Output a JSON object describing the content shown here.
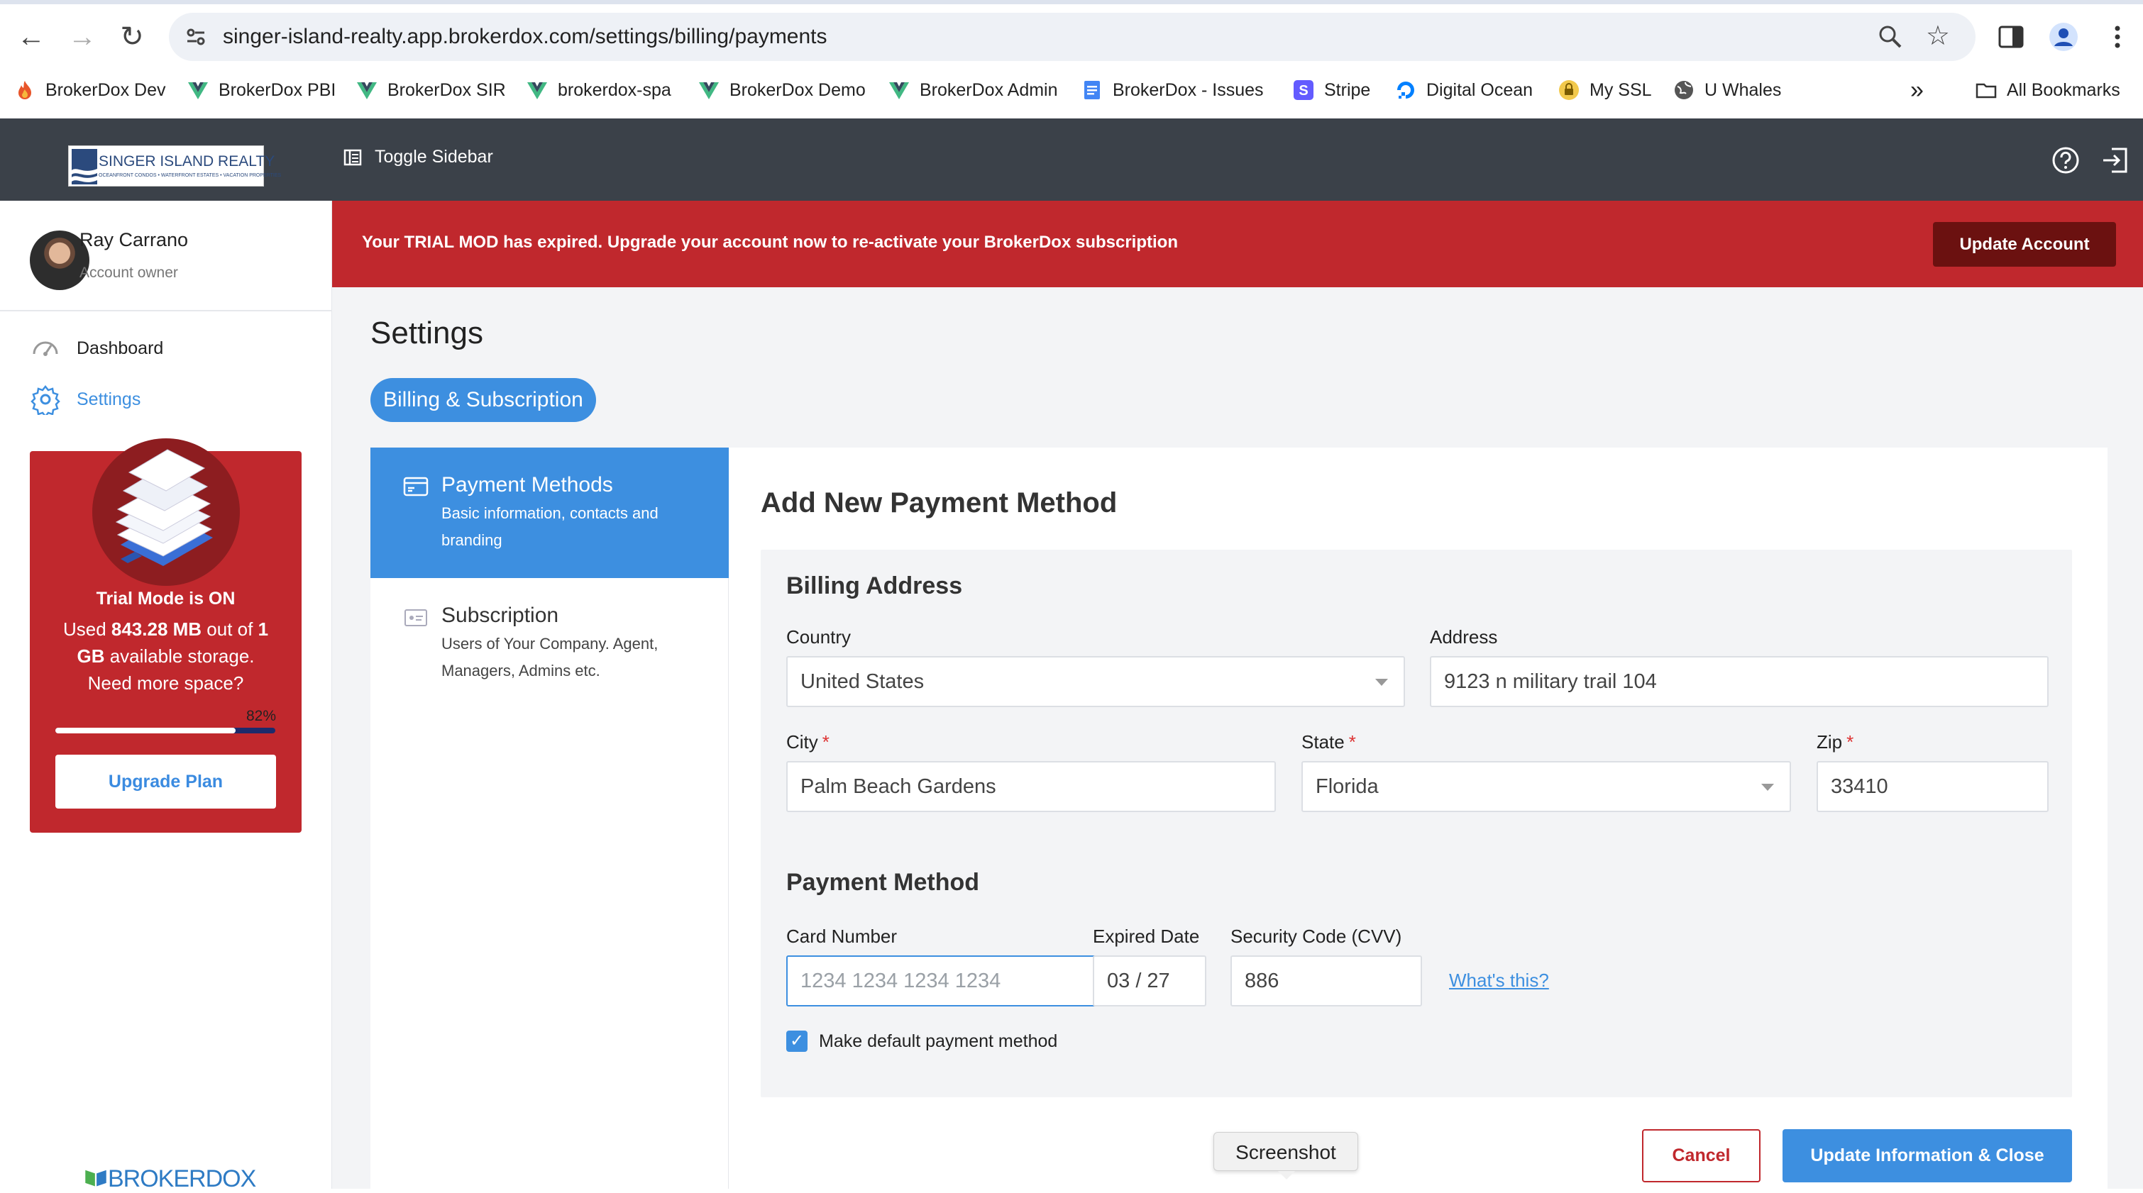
{
  "browser": {
    "url": "singer-island-realty.app.brokerdox.com/settings/billing/payments",
    "bookmarks": [
      "BrokerDox Dev",
      "BrokerDox PBI",
      "BrokerDox SIR",
      "brokerdox-spa",
      "BrokerDox Demo",
      "BrokerDox Admin",
      "BrokerDox - Issues",
      "Stripe",
      "Digital Ocean",
      "My SSL",
      "U Whales"
    ],
    "overflow": "»",
    "all_bookmarks": "All Bookmarks"
  },
  "header": {
    "logo_text": "SINGER ISLAND REALTY",
    "logo_sub": "OCEANFRONT CONDOS • WATERFRONT ESTATES • VACATION PROPERTIES",
    "toggle_label": "Toggle Sidebar"
  },
  "user": {
    "name": "Ray Carrano",
    "role": "Account owner"
  },
  "nav": {
    "dashboard": "Dashboard",
    "settings": "Settings"
  },
  "trial": {
    "title": "Trial Mode is ON",
    "used_prefix": "Used ",
    "used": "843.28 MB",
    "used_mid": " out of ",
    "total": "1 GB",
    "used_suffix": " available storage.",
    "need_more": "Need more space?",
    "percent_label": "82%",
    "percent": 0.82,
    "upgrade_label": "Upgrade Plan"
  },
  "banner": {
    "text": "Your TRIAL MOD has expired. Upgrade your account now to re-activate your BrokerDox subscription",
    "button": "Update Account",
    "color": "#c0282d"
  },
  "page": {
    "title": "Settings",
    "pill": "Billing & Subscription"
  },
  "tabs": [
    {
      "title": "Payment Methods",
      "desc": "Basic information, contacts and branding"
    },
    {
      "title": "Subscription",
      "desc": "Users of Your Company. Agent, Managers, Admins etc."
    }
  ],
  "form": {
    "title": "Add New Payment Method",
    "billing_title": "Billing Address",
    "country_label": "Country",
    "country_value": "United States",
    "address_label": "Address",
    "address_value": "9123 n military trail 104",
    "city_label": "City",
    "city_value": "Palm Beach Gardens",
    "state_label": "State",
    "state_value": "Florida",
    "zip_label": "Zip",
    "zip_value": "33410",
    "required_mark": "*",
    "payment_title": "Payment Method",
    "card_label": "Card Number",
    "card_placeholder": "1234 1234 1234 1234",
    "exp_label": "Expired Date",
    "exp_value": "03 / 27",
    "cvv_label": "Security Code (CVV)",
    "cvv_value": "886",
    "whats_this": "What's this?",
    "default_label": "Make default payment method",
    "cancel": "Cancel",
    "update": "Update Information & Close"
  },
  "brand_footer": "BROKERDOX",
  "tooltip": "Screenshot",
  "colors": {
    "accent": "#3d8fe0",
    "danger": "#c0282d",
    "header": "#3b4149"
  }
}
